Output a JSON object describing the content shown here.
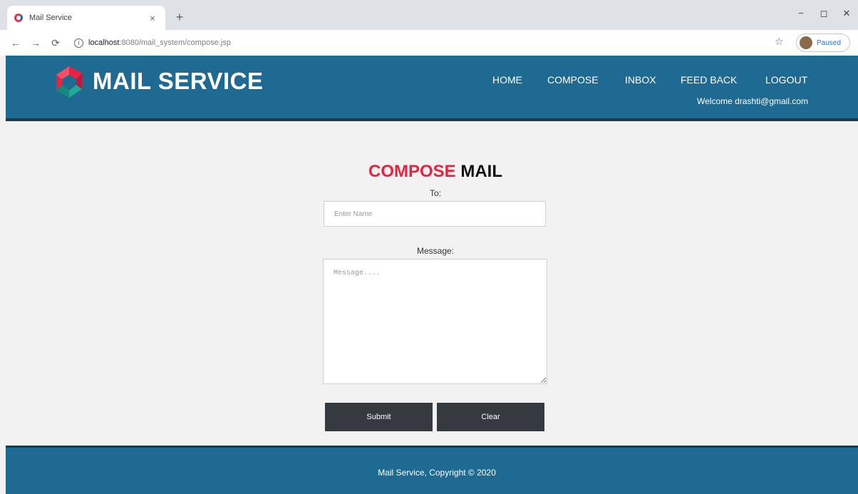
{
  "browser": {
    "tab_title": "Mail Service",
    "tab_close": "×",
    "new_tab": "+",
    "url_host": "localhost",
    "url_path": ":8080/mail_system/compose.jsp",
    "profile_label": "Paused",
    "window_controls": {
      "minimize": "−",
      "maximize": "◻",
      "close": "✕"
    }
  },
  "header": {
    "brand": "MAIL SERVICE",
    "nav": {
      "home": "HOME",
      "compose": "COMPOSE",
      "inbox": "INBOX",
      "feedback": "FEED BACK",
      "logout": "LOGOUT"
    },
    "welcome": "Welcome drashti@gmail.com"
  },
  "main": {
    "title_accent": "COMPOSE",
    "title_rest": " MAIL",
    "to_label": "To:",
    "to_placeholder": "Enter Name",
    "message_label": "Message:",
    "message_placeholder": "Message....",
    "submit_label": "Submit",
    "clear_label": "Clear"
  },
  "footer": {
    "text": "Mail Service, Copyright © 2020"
  },
  "colors": {
    "header_bg": "#1f6a93",
    "accent_red": "#e8223f",
    "button_bg": "#343a40",
    "page_bg": "#f2f2f2"
  }
}
